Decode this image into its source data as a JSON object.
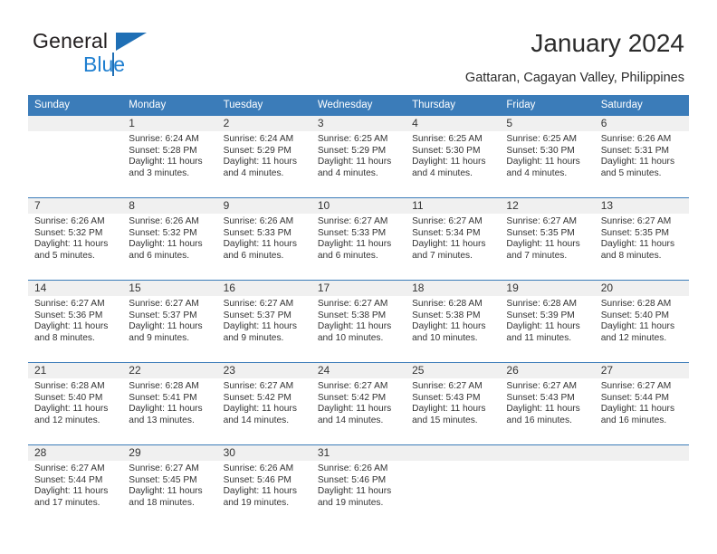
{
  "brand": {
    "name_top": "General",
    "name_bottom": "Blue",
    "triangle_color": "#1f6fb5",
    "blue_color": "#1f7fd0"
  },
  "header": {
    "title": "January 2024",
    "subtitle": "Gattaran, Cagayan Valley, Philippines"
  },
  "theme": {
    "header_bg": "#3b7cb9",
    "daynum_bg": "#f0f0f0",
    "rule_color": "#3b7cb9"
  },
  "calendar": {
    "weekday_headers": [
      "Sunday",
      "Monday",
      "Tuesday",
      "Wednesday",
      "Thursday",
      "Friday",
      "Saturday"
    ],
    "weeks": [
      [
        {
          "day": "",
          "sunrise": "",
          "sunset": "",
          "daylight_line1": "",
          "daylight_line2": ""
        },
        {
          "day": "1",
          "sunrise": "Sunrise: 6:24 AM",
          "sunset": "Sunset: 5:28 PM",
          "daylight_line1": "Daylight: 11 hours",
          "daylight_line2": "and 3 minutes."
        },
        {
          "day": "2",
          "sunrise": "Sunrise: 6:24 AM",
          "sunset": "Sunset: 5:29 PM",
          "daylight_line1": "Daylight: 11 hours",
          "daylight_line2": "and 4 minutes."
        },
        {
          "day": "3",
          "sunrise": "Sunrise: 6:25 AM",
          "sunset": "Sunset: 5:29 PM",
          "daylight_line1": "Daylight: 11 hours",
          "daylight_line2": "and 4 minutes."
        },
        {
          "day": "4",
          "sunrise": "Sunrise: 6:25 AM",
          "sunset": "Sunset: 5:30 PM",
          "daylight_line1": "Daylight: 11 hours",
          "daylight_line2": "and 4 minutes."
        },
        {
          "day": "5",
          "sunrise": "Sunrise: 6:25 AM",
          "sunset": "Sunset: 5:30 PM",
          "daylight_line1": "Daylight: 11 hours",
          "daylight_line2": "and 4 minutes."
        },
        {
          "day": "6",
          "sunrise": "Sunrise: 6:26 AM",
          "sunset": "Sunset: 5:31 PM",
          "daylight_line1": "Daylight: 11 hours",
          "daylight_line2": "and 5 minutes."
        }
      ],
      [
        {
          "day": "7",
          "sunrise": "Sunrise: 6:26 AM",
          "sunset": "Sunset: 5:32 PM",
          "daylight_line1": "Daylight: 11 hours",
          "daylight_line2": "and 5 minutes."
        },
        {
          "day": "8",
          "sunrise": "Sunrise: 6:26 AM",
          "sunset": "Sunset: 5:32 PM",
          "daylight_line1": "Daylight: 11 hours",
          "daylight_line2": "and 6 minutes."
        },
        {
          "day": "9",
          "sunrise": "Sunrise: 6:26 AM",
          "sunset": "Sunset: 5:33 PM",
          "daylight_line1": "Daylight: 11 hours",
          "daylight_line2": "and 6 minutes."
        },
        {
          "day": "10",
          "sunrise": "Sunrise: 6:27 AM",
          "sunset": "Sunset: 5:33 PM",
          "daylight_line1": "Daylight: 11 hours",
          "daylight_line2": "and 6 minutes."
        },
        {
          "day": "11",
          "sunrise": "Sunrise: 6:27 AM",
          "sunset": "Sunset: 5:34 PM",
          "daylight_line1": "Daylight: 11 hours",
          "daylight_line2": "and 7 minutes."
        },
        {
          "day": "12",
          "sunrise": "Sunrise: 6:27 AM",
          "sunset": "Sunset: 5:35 PM",
          "daylight_line1": "Daylight: 11 hours",
          "daylight_line2": "and 7 minutes."
        },
        {
          "day": "13",
          "sunrise": "Sunrise: 6:27 AM",
          "sunset": "Sunset: 5:35 PM",
          "daylight_line1": "Daylight: 11 hours",
          "daylight_line2": "and 8 minutes."
        }
      ],
      [
        {
          "day": "14",
          "sunrise": "Sunrise: 6:27 AM",
          "sunset": "Sunset: 5:36 PM",
          "daylight_line1": "Daylight: 11 hours",
          "daylight_line2": "and 8 minutes."
        },
        {
          "day": "15",
          "sunrise": "Sunrise: 6:27 AM",
          "sunset": "Sunset: 5:37 PM",
          "daylight_line1": "Daylight: 11 hours",
          "daylight_line2": "and 9 minutes."
        },
        {
          "day": "16",
          "sunrise": "Sunrise: 6:27 AM",
          "sunset": "Sunset: 5:37 PM",
          "daylight_line1": "Daylight: 11 hours",
          "daylight_line2": "and 9 minutes."
        },
        {
          "day": "17",
          "sunrise": "Sunrise: 6:27 AM",
          "sunset": "Sunset: 5:38 PM",
          "daylight_line1": "Daylight: 11 hours",
          "daylight_line2": "and 10 minutes."
        },
        {
          "day": "18",
          "sunrise": "Sunrise: 6:28 AM",
          "sunset": "Sunset: 5:38 PM",
          "daylight_line1": "Daylight: 11 hours",
          "daylight_line2": "and 10 minutes."
        },
        {
          "day": "19",
          "sunrise": "Sunrise: 6:28 AM",
          "sunset": "Sunset: 5:39 PM",
          "daylight_line1": "Daylight: 11 hours",
          "daylight_line2": "and 11 minutes."
        },
        {
          "day": "20",
          "sunrise": "Sunrise: 6:28 AM",
          "sunset": "Sunset: 5:40 PM",
          "daylight_line1": "Daylight: 11 hours",
          "daylight_line2": "and 12 minutes."
        }
      ],
      [
        {
          "day": "21",
          "sunrise": "Sunrise: 6:28 AM",
          "sunset": "Sunset: 5:40 PM",
          "daylight_line1": "Daylight: 11 hours",
          "daylight_line2": "and 12 minutes."
        },
        {
          "day": "22",
          "sunrise": "Sunrise: 6:28 AM",
          "sunset": "Sunset: 5:41 PM",
          "daylight_line1": "Daylight: 11 hours",
          "daylight_line2": "and 13 minutes."
        },
        {
          "day": "23",
          "sunrise": "Sunrise: 6:27 AM",
          "sunset": "Sunset: 5:42 PM",
          "daylight_line1": "Daylight: 11 hours",
          "daylight_line2": "and 14 minutes."
        },
        {
          "day": "24",
          "sunrise": "Sunrise: 6:27 AM",
          "sunset": "Sunset: 5:42 PM",
          "daylight_line1": "Daylight: 11 hours",
          "daylight_line2": "and 14 minutes."
        },
        {
          "day": "25",
          "sunrise": "Sunrise: 6:27 AM",
          "sunset": "Sunset: 5:43 PM",
          "daylight_line1": "Daylight: 11 hours",
          "daylight_line2": "and 15 minutes."
        },
        {
          "day": "26",
          "sunrise": "Sunrise: 6:27 AM",
          "sunset": "Sunset: 5:43 PM",
          "daylight_line1": "Daylight: 11 hours",
          "daylight_line2": "and 16 minutes."
        },
        {
          "day": "27",
          "sunrise": "Sunrise: 6:27 AM",
          "sunset": "Sunset: 5:44 PM",
          "daylight_line1": "Daylight: 11 hours",
          "daylight_line2": "and 16 minutes."
        }
      ],
      [
        {
          "day": "28",
          "sunrise": "Sunrise: 6:27 AM",
          "sunset": "Sunset: 5:44 PM",
          "daylight_line1": "Daylight: 11 hours",
          "daylight_line2": "and 17 minutes."
        },
        {
          "day": "29",
          "sunrise": "Sunrise: 6:27 AM",
          "sunset": "Sunset: 5:45 PM",
          "daylight_line1": "Daylight: 11 hours",
          "daylight_line2": "and 18 minutes."
        },
        {
          "day": "30",
          "sunrise": "Sunrise: 6:26 AM",
          "sunset": "Sunset: 5:46 PM",
          "daylight_line1": "Daylight: 11 hours",
          "daylight_line2": "and 19 minutes."
        },
        {
          "day": "31",
          "sunrise": "Sunrise: 6:26 AM",
          "sunset": "Sunset: 5:46 PM",
          "daylight_line1": "Daylight: 11 hours",
          "daylight_line2": "and 19 minutes."
        },
        {
          "day": "",
          "sunrise": "",
          "sunset": "",
          "daylight_line1": "",
          "daylight_line2": ""
        },
        {
          "day": "",
          "sunrise": "",
          "sunset": "",
          "daylight_line1": "",
          "daylight_line2": ""
        },
        {
          "day": "",
          "sunrise": "",
          "sunset": "",
          "daylight_line1": "",
          "daylight_line2": ""
        }
      ]
    ]
  }
}
